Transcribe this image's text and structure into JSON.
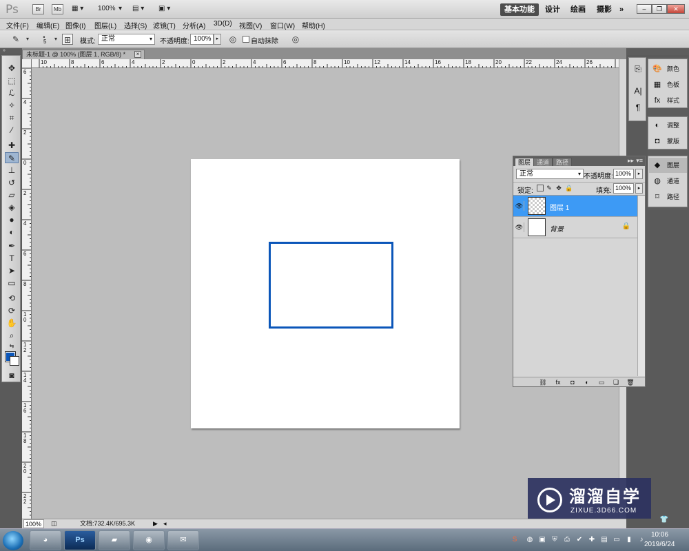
{
  "app": {
    "logo": "Ps",
    "bridge_label": "Br",
    "minibridge_label": "Mb",
    "zoom": "100%"
  },
  "workspaces": [
    "基本功能",
    "设计",
    "绘画",
    "摄影"
  ],
  "workspace_more": "»",
  "menu": [
    "文件(F)",
    "编辑(E)",
    "图像(I)",
    "图层(L)",
    "选择(S)",
    "滤镜(T)",
    "分析(A)",
    "3D(D)",
    "视图(V)",
    "窗口(W)",
    "帮助(H)"
  ],
  "options": {
    "brush_size": "5",
    "mode_label": "模式:",
    "mode_value": "正常",
    "opacity_label": "不透明度:",
    "opacity_value": "100%",
    "auto_erase_label": "自动抹除"
  },
  "document": {
    "tab_title": "未标题-1 @ 100% (图层 1, RGB/8) *",
    "close": "×",
    "rect_color": "#0b56b9",
    "fg_color": "#0b56b9",
    "bg_color": "#ffffff"
  },
  "ruler_top": [
    "10",
    "8",
    "6",
    "4",
    "2",
    "0",
    "2",
    "4",
    "6",
    "8",
    "10",
    "12",
    "14",
    "16",
    "18",
    "20",
    "22",
    "24",
    "26"
  ],
  "ruler_left": [
    "6",
    "4",
    "2",
    "0",
    "2",
    "4",
    "6",
    "8",
    "1\n0",
    "1\n2",
    "1\n4",
    "1\n6",
    "1\n8",
    "2\n0",
    "2\n2"
  ],
  "status": {
    "zoom": "100%",
    "doc_info": "文档:732.4K/695.3K"
  },
  "right_dock": {
    "items": [
      {
        "icon": "palette-icon",
        "label": "颜色"
      },
      {
        "icon": "swatches-icon",
        "label": "色板"
      },
      {
        "icon": "fx-icon",
        "label": "样式"
      },
      {
        "icon": "adjust-icon",
        "label": "调整"
      },
      {
        "icon": "mask-icon",
        "label": "蒙版"
      },
      {
        "icon": "layers-icon",
        "label": "图层"
      },
      {
        "icon": "channels-icon",
        "label": "通道"
      },
      {
        "icon": "paths-icon",
        "label": "路径"
      }
    ]
  },
  "layers_panel": {
    "tabs": [
      "图层",
      "通道",
      "路径"
    ],
    "blend_mode": "正常",
    "opacity_label": "不透明度:",
    "opacity_value": "100%",
    "lock_label": "锁定:",
    "fill_label": "填充:",
    "fill_value": "100%",
    "layers": [
      {
        "name": "图层 1",
        "selected": true
      },
      {
        "name": "背景",
        "selected": false,
        "locked": true
      }
    ]
  },
  "watermark": {
    "title": "溜溜自学",
    "url": "ZIXUE.3D66.COM"
  },
  "taskbar": {
    "ps_label": "Ps",
    "time": "10:06",
    "date": "2019/6/24"
  }
}
